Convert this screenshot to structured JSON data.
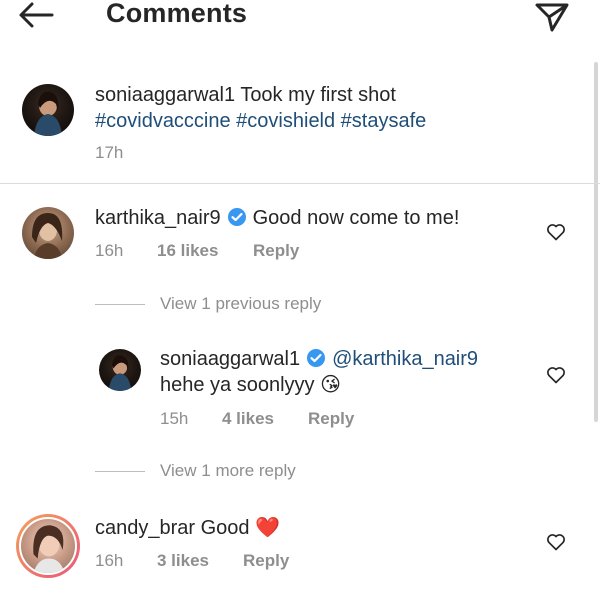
{
  "header": {
    "title": "Comments"
  },
  "caption": {
    "username": "soniaaggarwal1",
    "text": "Took my first shot",
    "hashtags": "#covidvacccine #covishield #staysafe",
    "time": "17h"
  },
  "comments": [
    {
      "username": "karthika_nair9",
      "text": "Good now come to me!",
      "time": "16h",
      "likes": "16 likes",
      "reply": "Reply",
      "view_replies": "View 1 previous reply",
      "replies": [
        {
          "username": "soniaaggarwal1",
          "mention": "@karthika_nair9",
          "text": "hehe ya soonlyyy",
          "emoji": "😘",
          "time": "15h",
          "likes": "4 likes",
          "reply": "Reply"
        }
      ],
      "view_more": "View 1 more reply"
    },
    {
      "username": "candy_brar",
      "text": "Good",
      "emoji": "❤️",
      "time": "16h",
      "likes": "3 likes",
      "reply": "Reply"
    }
  ],
  "colors": {
    "link": "#1f4e79",
    "muted": "#8e8e8e",
    "heart": "#e0245e",
    "verified": "#3897f0"
  }
}
